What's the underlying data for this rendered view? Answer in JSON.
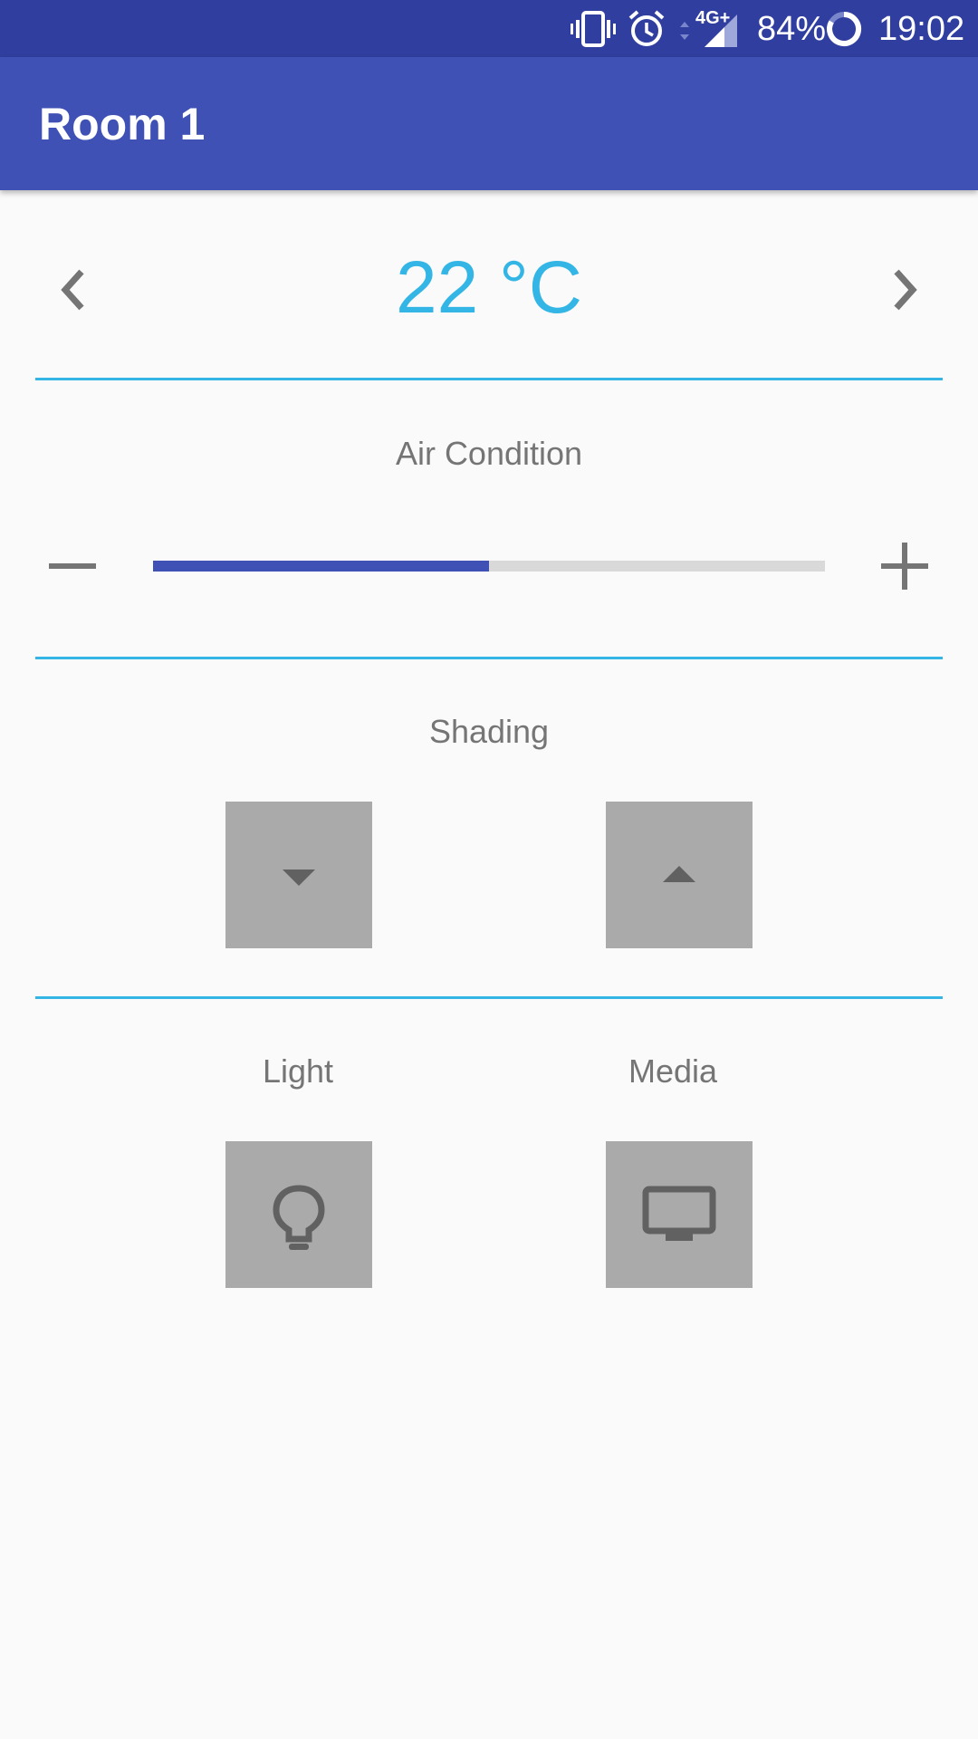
{
  "status_bar": {
    "battery": "84%",
    "time": "19:02",
    "network": "4G+",
    "icons": [
      "vibrate-icon",
      "alarm-icon",
      "data-arrows-icon",
      "signal-icon",
      "battery-ring-icon"
    ]
  },
  "app_bar": {
    "title": "Room 1"
  },
  "temperature": {
    "value": "22 °C",
    "prev_icon": "chevron-left-icon",
    "next_icon": "chevron-right-icon"
  },
  "air_condition": {
    "label": "Air Condition",
    "level": 0.5,
    "decrease_icon": "minus-icon",
    "increase_icon": "plus-icon"
  },
  "shading": {
    "label": "Shading",
    "down_icon": "arrow-down-icon",
    "up_icon": "arrow-up-icon"
  },
  "light": {
    "label": "Light",
    "icon": "lightbulb-icon"
  },
  "media": {
    "label": "Media",
    "icon": "tv-icon"
  },
  "colors": {
    "status_bar": "#303f9f",
    "app_bar": "#3f51b5",
    "accent": "#33b5e5",
    "slider_fill": "#3f51b5",
    "slider_track": "#d9d9d9",
    "tile": "#aaaaaa",
    "icon_dark": "#616161"
  }
}
